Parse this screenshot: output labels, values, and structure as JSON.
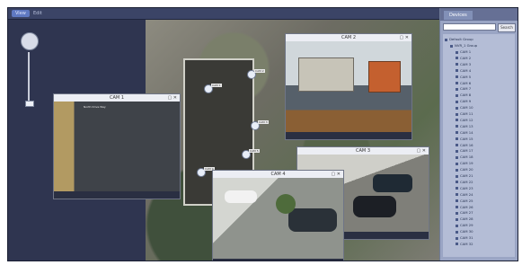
{
  "app": {
    "top_tabs": [
      {
        "label": "View"
      },
      {
        "label": "Edit"
      }
    ]
  },
  "sidebar": {
    "tabs": [
      {
        "label": "Devices"
      },
      {
        "label": ""
      }
    ],
    "search": {
      "placeholder": "Search",
      "button_label": "Search"
    },
    "tree": {
      "root": "Default Group",
      "group": "NVR_1 Group",
      "items": [
        "CAM 1",
        "CAM 2",
        "CAM 3",
        "CAM 4",
        "CAM 5",
        "CAM 6",
        "CAM 7",
        "CAM 8",
        "CAM 9",
        "CAM 10",
        "CAM 11",
        "CAM 12",
        "CAM 13",
        "CAM 14",
        "CAM 15",
        "CAM 16",
        "CAM 17",
        "CAM 18",
        "CAM 19",
        "CAM 20",
        "CAM 21",
        "CAM 22",
        "CAM 23",
        "CAM 24",
        "CAM 25",
        "CAM 26",
        "CAM 27",
        "CAM 28",
        "CAM 29",
        "CAM 30",
        "CAM 31",
        "CAM 32"
      ]
    }
  },
  "windows": [
    {
      "title": "CAM 1",
      "overlay": "North Drive Way"
    },
    {
      "title": "CAM 2",
      "overlay": ""
    },
    {
      "title": "CAM 3",
      "overlay": ""
    },
    {
      "title": "CAM 4",
      "overlay": ""
    }
  ],
  "map": {
    "markers": [
      "CAM 1",
      "CAM 2",
      "CAM 3",
      "CAM 4",
      "CAM 5",
      "CAM 6",
      "CAM 7",
      "CAM 8"
    ]
  }
}
